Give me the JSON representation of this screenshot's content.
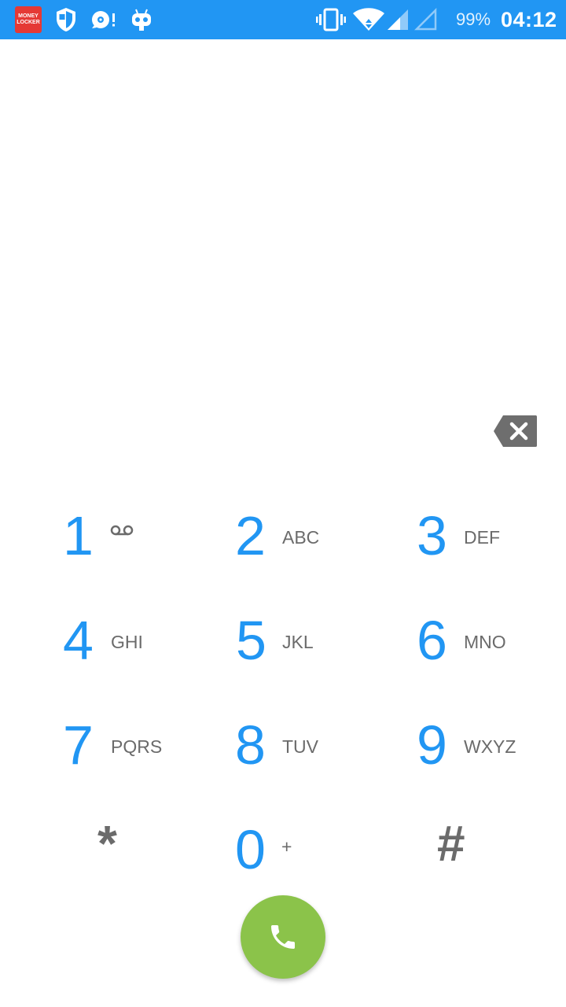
{
  "status_bar": {
    "notification_icons": [
      "money-locker-icon",
      "shield-icon",
      "sync-alert-icon",
      "android-bot-icon"
    ],
    "money_locker_text": [
      "MONEY",
      "LOCKER"
    ],
    "system_icons": [
      "vibrate-icon",
      "wifi-icon",
      "signal-icon",
      "signal-empty-icon"
    ],
    "battery": "99%",
    "time": "04:12",
    "background_color": "#2196F3"
  },
  "dialpad": {
    "keys": [
      {
        "digit": "1",
        "letters": "",
        "icon": "voicemail-icon"
      },
      {
        "digit": "2",
        "letters": "ABC"
      },
      {
        "digit": "3",
        "letters": "DEF"
      },
      {
        "digit": "4",
        "letters": "GHI"
      },
      {
        "digit": "5",
        "letters": "JKL"
      },
      {
        "digit": "6",
        "letters": "MNO"
      },
      {
        "digit": "7",
        "letters": "PQRS"
      },
      {
        "digit": "8",
        "letters": "TUV"
      },
      {
        "digit": "9",
        "letters": "WXYZ"
      },
      {
        "digit": "*",
        "letters": ""
      },
      {
        "digit": "0",
        "letters": "+"
      },
      {
        "digit": "#",
        "letters": ""
      }
    ],
    "digit_color": "#2196F3",
    "letters_color": "#6b6b6b"
  },
  "backspace": {
    "icon": "backspace-icon"
  },
  "call_button": {
    "icon": "phone-icon",
    "color": "#8BC34A"
  }
}
